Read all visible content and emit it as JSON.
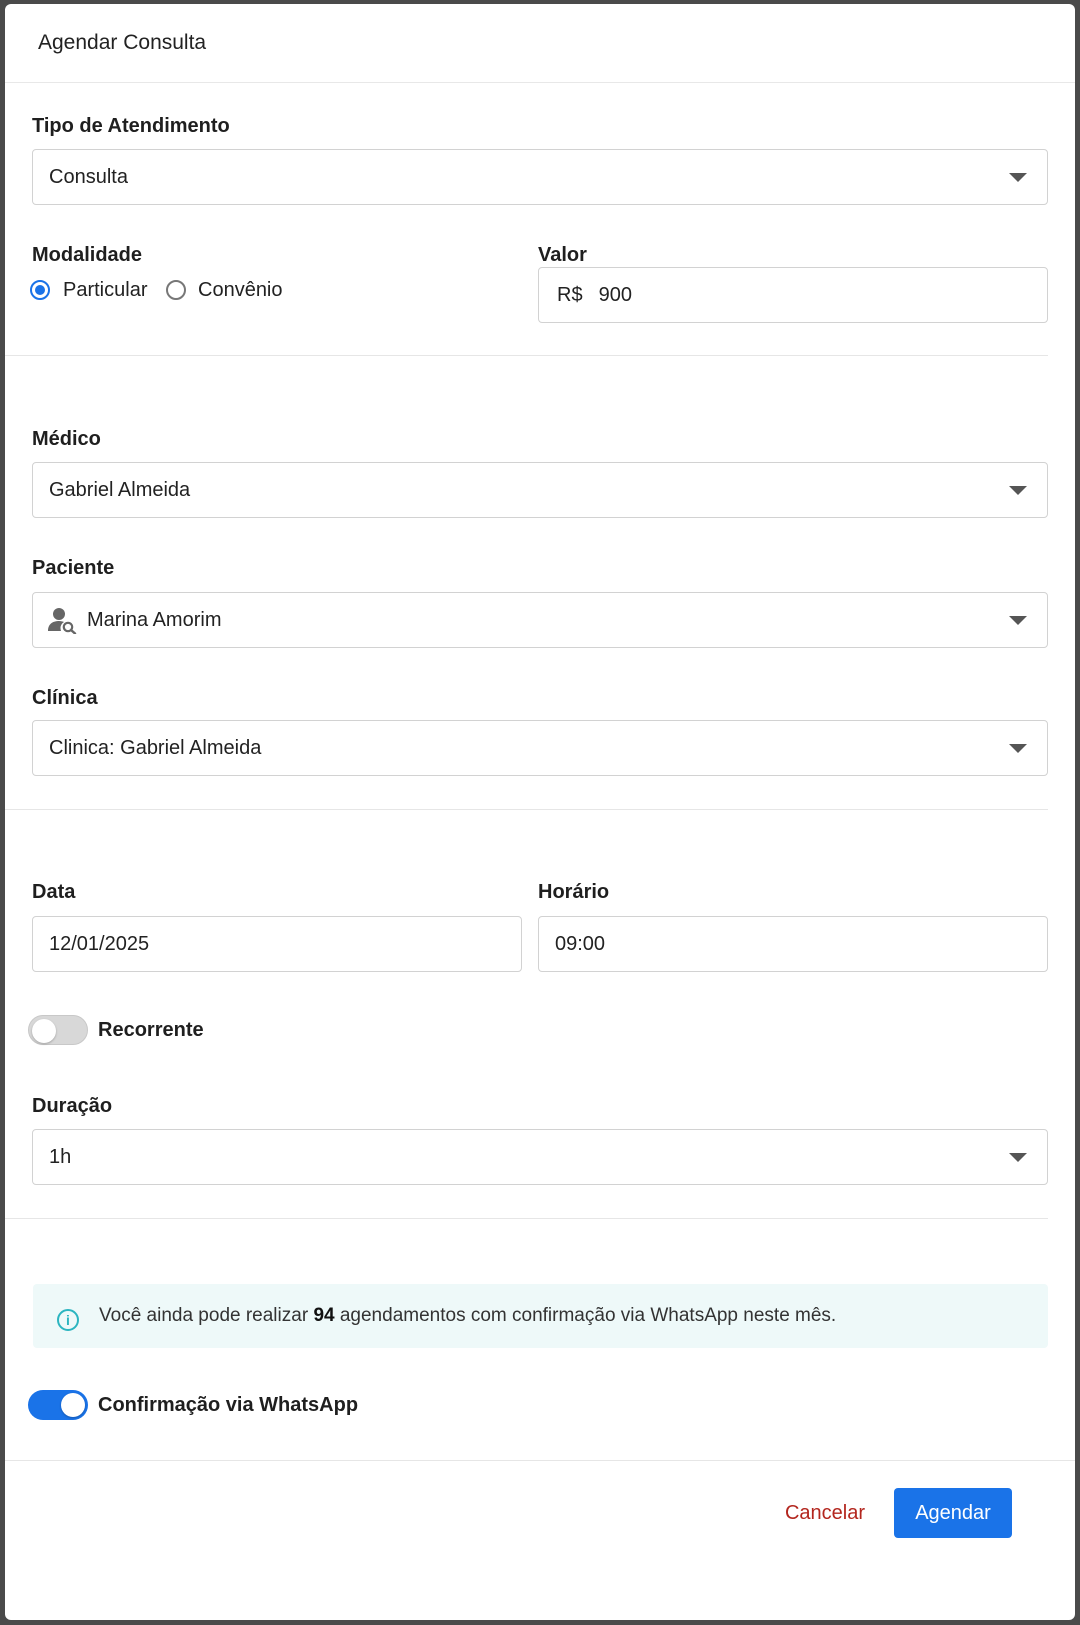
{
  "modal": {
    "title": "Agendar Consulta"
  },
  "tipo_atendimento": {
    "label": "Tipo de Atendimento",
    "value": "Consulta"
  },
  "modalidade": {
    "label": "Modalidade",
    "options": [
      "Particular",
      "Convênio"
    ],
    "selected": "Particular"
  },
  "valor": {
    "label": "Valor",
    "prefix": "R$",
    "value": "900"
  },
  "medico": {
    "label": "Médico",
    "value": "Gabriel Almeida"
  },
  "paciente": {
    "label": "Paciente",
    "value": "Marina Amorim",
    "icon": "user-search-icon"
  },
  "clinica": {
    "label": "Clínica",
    "value": "Clinica: Gabriel Almeida"
  },
  "data": {
    "label": "Data",
    "value": "12/01/2025"
  },
  "horario": {
    "label": "Horário",
    "value": "09:00"
  },
  "recorrente": {
    "label": "Recorrente",
    "on": false
  },
  "duracao": {
    "label": "Duração",
    "value": "1h"
  },
  "info": {
    "icon": "info-icon",
    "text_before": "Você ainda pode realizar ",
    "count": "94",
    "text_after": " agendamentos com confirmação via WhatsApp neste mês."
  },
  "whatsapp": {
    "label": "Confirmação via WhatsApp",
    "on": true
  },
  "footer": {
    "cancel_label": "Cancelar",
    "submit_label": "Agendar"
  },
  "colors": {
    "primary": "#1a73e8",
    "danger": "#b3261e",
    "info": "#2cb5c0"
  }
}
